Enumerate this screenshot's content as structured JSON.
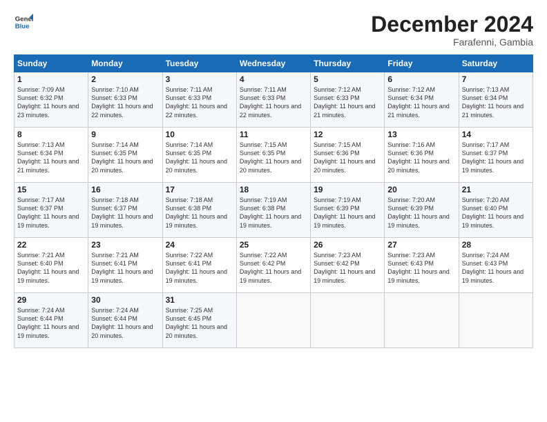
{
  "logo": {
    "line1": "General",
    "line2": "Blue"
  },
  "title": "December 2024",
  "location": "Farafenni, Gambia",
  "days_header": [
    "Sunday",
    "Monday",
    "Tuesday",
    "Wednesday",
    "Thursday",
    "Friday",
    "Saturday"
  ],
  "weeks": [
    [
      {
        "day": "1",
        "sunrise": "Sunrise: 7:09 AM",
        "sunset": "Sunset: 6:32 PM",
        "daylight": "Daylight: 11 hours and 23 minutes."
      },
      {
        "day": "2",
        "sunrise": "Sunrise: 7:10 AM",
        "sunset": "Sunset: 6:33 PM",
        "daylight": "Daylight: 11 hours and 22 minutes."
      },
      {
        "day": "3",
        "sunrise": "Sunrise: 7:11 AM",
        "sunset": "Sunset: 6:33 PM",
        "daylight": "Daylight: 11 hours and 22 minutes."
      },
      {
        "day": "4",
        "sunrise": "Sunrise: 7:11 AM",
        "sunset": "Sunset: 6:33 PM",
        "daylight": "Daylight: 11 hours and 22 minutes."
      },
      {
        "day": "5",
        "sunrise": "Sunrise: 7:12 AM",
        "sunset": "Sunset: 6:33 PM",
        "daylight": "Daylight: 11 hours and 21 minutes."
      },
      {
        "day": "6",
        "sunrise": "Sunrise: 7:12 AM",
        "sunset": "Sunset: 6:34 PM",
        "daylight": "Daylight: 11 hours and 21 minutes."
      },
      {
        "day": "7",
        "sunrise": "Sunrise: 7:13 AM",
        "sunset": "Sunset: 6:34 PM",
        "daylight": "Daylight: 11 hours and 21 minutes."
      }
    ],
    [
      {
        "day": "8",
        "sunrise": "Sunrise: 7:13 AM",
        "sunset": "Sunset: 6:34 PM",
        "daylight": "Daylight: 11 hours and 21 minutes."
      },
      {
        "day": "9",
        "sunrise": "Sunrise: 7:14 AM",
        "sunset": "Sunset: 6:35 PM",
        "daylight": "Daylight: 11 hours and 20 minutes."
      },
      {
        "day": "10",
        "sunrise": "Sunrise: 7:14 AM",
        "sunset": "Sunset: 6:35 PM",
        "daylight": "Daylight: 11 hours and 20 minutes."
      },
      {
        "day": "11",
        "sunrise": "Sunrise: 7:15 AM",
        "sunset": "Sunset: 6:35 PM",
        "daylight": "Daylight: 11 hours and 20 minutes."
      },
      {
        "day": "12",
        "sunrise": "Sunrise: 7:15 AM",
        "sunset": "Sunset: 6:36 PM",
        "daylight": "Daylight: 11 hours and 20 minutes."
      },
      {
        "day": "13",
        "sunrise": "Sunrise: 7:16 AM",
        "sunset": "Sunset: 6:36 PM",
        "daylight": "Daylight: 11 hours and 20 minutes."
      },
      {
        "day": "14",
        "sunrise": "Sunrise: 7:17 AM",
        "sunset": "Sunset: 6:37 PM",
        "daylight": "Daylight: 11 hours and 19 minutes."
      }
    ],
    [
      {
        "day": "15",
        "sunrise": "Sunrise: 7:17 AM",
        "sunset": "Sunset: 6:37 PM",
        "daylight": "Daylight: 11 hours and 19 minutes."
      },
      {
        "day": "16",
        "sunrise": "Sunrise: 7:18 AM",
        "sunset": "Sunset: 6:37 PM",
        "daylight": "Daylight: 11 hours and 19 minutes."
      },
      {
        "day": "17",
        "sunrise": "Sunrise: 7:18 AM",
        "sunset": "Sunset: 6:38 PM",
        "daylight": "Daylight: 11 hours and 19 minutes."
      },
      {
        "day": "18",
        "sunrise": "Sunrise: 7:19 AM",
        "sunset": "Sunset: 6:38 PM",
        "daylight": "Daylight: 11 hours and 19 minutes."
      },
      {
        "day": "19",
        "sunrise": "Sunrise: 7:19 AM",
        "sunset": "Sunset: 6:39 PM",
        "daylight": "Daylight: 11 hours and 19 minutes."
      },
      {
        "day": "20",
        "sunrise": "Sunrise: 7:20 AM",
        "sunset": "Sunset: 6:39 PM",
        "daylight": "Daylight: 11 hours and 19 minutes."
      },
      {
        "day": "21",
        "sunrise": "Sunrise: 7:20 AM",
        "sunset": "Sunset: 6:40 PM",
        "daylight": "Daylight: 11 hours and 19 minutes."
      }
    ],
    [
      {
        "day": "22",
        "sunrise": "Sunrise: 7:21 AM",
        "sunset": "Sunset: 6:40 PM",
        "daylight": "Daylight: 11 hours and 19 minutes."
      },
      {
        "day": "23",
        "sunrise": "Sunrise: 7:21 AM",
        "sunset": "Sunset: 6:41 PM",
        "daylight": "Daylight: 11 hours and 19 minutes."
      },
      {
        "day": "24",
        "sunrise": "Sunrise: 7:22 AM",
        "sunset": "Sunset: 6:41 PM",
        "daylight": "Daylight: 11 hours and 19 minutes."
      },
      {
        "day": "25",
        "sunrise": "Sunrise: 7:22 AM",
        "sunset": "Sunset: 6:42 PM",
        "daylight": "Daylight: 11 hours and 19 minutes."
      },
      {
        "day": "26",
        "sunrise": "Sunrise: 7:23 AM",
        "sunset": "Sunset: 6:42 PM",
        "daylight": "Daylight: 11 hours and 19 minutes."
      },
      {
        "day": "27",
        "sunrise": "Sunrise: 7:23 AM",
        "sunset": "Sunset: 6:43 PM",
        "daylight": "Daylight: 11 hours and 19 minutes."
      },
      {
        "day": "28",
        "sunrise": "Sunrise: 7:24 AM",
        "sunset": "Sunset: 6:43 PM",
        "daylight": "Daylight: 11 hours and 19 minutes."
      }
    ],
    [
      {
        "day": "29",
        "sunrise": "Sunrise: 7:24 AM",
        "sunset": "Sunset: 6:44 PM",
        "daylight": "Daylight: 11 hours and 19 minutes."
      },
      {
        "day": "30",
        "sunrise": "Sunrise: 7:24 AM",
        "sunset": "Sunset: 6:44 PM",
        "daylight": "Daylight: 11 hours and 20 minutes."
      },
      {
        "day": "31",
        "sunrise": "Sunrise: 7:25 AM",
        "sunset": "Sunset: 6:45 PM",
        "daylight": "Daylight: 11 hours and 20 minutes."
      },
      null,
      null,
      null,
      null
    ]
  ]
}
